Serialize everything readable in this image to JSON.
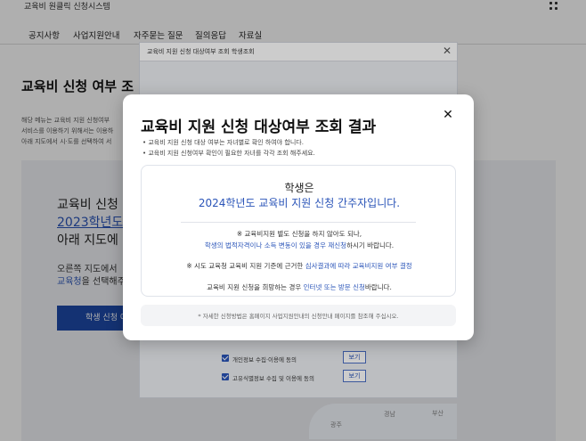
{
  "site": {
    "title": "교육비 원클릭 신청시스템",
    "menu_icon": "grid-icon"
  },
  "nav": {
    "items": [
      "공지사항",
      "사업지원안내",
      "자주묻는 질문",
      "질의응답",
      "자료실"
    ]
  },
  "page": {
    "heading": "교육비 신청 여부 조",
    "desc": [
      "해당 메뉴는 교육비 지원 신청여부",
      "서비스를 이용하기 위해서는 이용하",
      "아래 지도에서 시·도를 선택하여 서"
    ],
    "panel_line1": "교육비 신청",
    "panel_line2": "2023학년도",
    "panel_line3": "아래 지도에",
    "panel_sub1": "오른쪽 지도에서",
    "panel_sub2_highlight": "교육청",
    "panel_sub2_rest": "을 선택해주",
    "button_label": "학생 신청 여부"
  },
  "sub_modal": {
    "title": "교육비 지원 신청 대상여부 조회 학생조회",
    "close": "✕",
    "consents": [
      {
        "label": "개인정보 수집·이용에 동의",
        "button": "보기"
      },
      {
        "label": "고유식별정보 수집 및 이용에 동의",
        "button": "보기"
      }
    ],
    "map_labels": [
      "경남",
      "부산",
      "광주"
    ]
  },
  "modal": {
    "title": "교육비 지원 신청 대상여부 조회 결과",
    "close": "✕",
    "notes": [
      "• 교육비 지원 신청 대상 여부는 자녀별로 확인 하여야 합니다.",
      "• 교육비 지원 신청여부 확인이 필요한 자녀를 각각 조회 해주세요."
    ],
    "result_head1": "학생은",
    "result_head2": "2024학년도 교육비 지원 신청 간주자입니다.",
    "line1": "※ 교육비지원 별도 신청을 하지 않아도 되나,",
    "line2_blue": "학생의 법적자격이나 소득 변동이 있을 경우 재신청",
    "line2_rest": "하시기 바랍니다.",
    "line3_a": "※ 시도 교육청 교육비 지원 기준에 근거한 ",
    "line3_blue": "심사결과에 따라 교육비지원 여부 결정",
    "line4_a": "교육비 지원 신청을 희망하는 경우 ",
    "line4_blue": "인터넷 또는 방문 신청",
    "line4_rest": "바랍니다.",
    "footer": "* 자세한 신청방법은 홈페이지 사업지원안내의 신청안내 페이지를 참조해 주십시오."
  }
}
